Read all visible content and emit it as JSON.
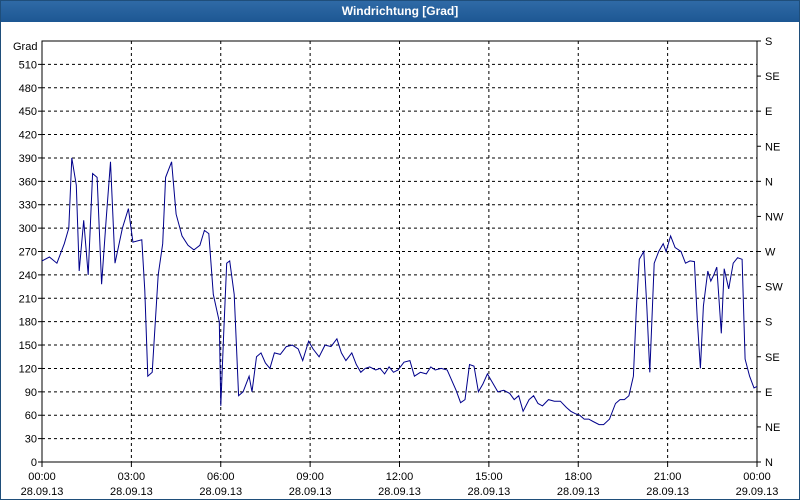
{
  "window": {
    "title": "Windrichtung [Grad]"
  },
  "chart_data": {
    "type": "line",
    "title": "Windrichtung [Grad]",
    "ylabel": "Grad",
    "ylim": [
      0,
      540
    ],
    "yticks": [
      0,
      30,
      60,
      90,
      120,
      150,
      180,
      210,
      240,
      270,
      300,
      330,
      360,
      390,
      420,
      450,
      480,
      510
    ],
    "right_axis": {
      "labels": [
        {
          "value": 0,
          "label": "N"
        },
        {
          "value": 45,
          "label": "NE"
        },
        {
          "value": 90,
          "label": "E"
        },
        {
          "value": 135,
          "label": "SE"
        },
        {
          "value": 180,
          "label": "S"
        },
        {
          "value": 225,
          "label": "SW"
        },
        {
          "value": 270,
          "label": "W"
        },
        {
          "value": 315,
          "label": "NW"
        },
        {
          "value": 360,
          "label": "N"
        },
        {
          "value": 405,
          "label": "NE"
        },
        {
          "value": 450,
          "label": "E"
        },
        {
          "value": 495,
          "label": "SE"
        },
        {
          "value": 540,
          "label": "S"
        }
      ]
    },
    "x_ticks": [
      {
        "time": "00:00",
        "date": "28.09.13",
        "hour": 0
      },
      {
        "time": "03:00",
        "date": "28.09.13",
        "hour": 3
      },
      {
        "time": "06:00",
        "date": "28.09.13",
        "hour": 6
      },
      {
        "time": "09:00",
        "date": "28.09.13",
        "hour": 9
      },
      {
        "time": "12:00",
        "date": "28.09.13",
        "hour": 12
      },
      {
        "time": "15:00",
        "date": "28.09.13",
        "hour": 15
      },
      {
        "time": "18:00",
        "date": "28.09.13",
        "hour": 18
      },
      {
        "time": "21:00",
        "date": "28.09.13",
        "hour": 21
      },
      {
        "time": "00:00",
        "date": "29.09.13",
        "hour": 24
      }
    ],
    "xlim_hours": [
      0,
      24
    ],
    "grid": true,
    "line_color": "#00008b",
    "series": [
      {
        "name": "",
        "points": [
          [
            0.0,
            258
          ],
          [
            0.25,
            263
          ],
          [
            0.5,
            255
          ],
          [
            0.75,
            280
          ],
          [
            0.9,
            300
          ],
          [
            1.0,
            390
          ],
          [
            1.15,
            355
          ],
          [
            1.25,
            245
          ],
          [
            1.4,
            310
          ],
          [
            1.55,
            240
          ],
          [
            1.7,
            370
          ],
          [
            1.85,
            365
          ],
          [
            2.0,
            228
          ],
          [
            2.15,
            310
          ],
          [
            2.3,
            385
          ],
          [
            2.45,
            255
          ],
          [
            2.7,
            300
          ],
          [
            2.9,
            325
          ],
          [
            3.05,
            282
          ],
          [
            3.35,
            285
          ],
          [
            3.45,
            220
          ],
          [
            3.55,
            110
          ],
          [
            3.7,
            115
          ],
          [
            3.9,
            240
          ],
          [
            4.05,
            280
          ],
          [
            4.15,
            365
          ],
          [
            4.35,
            385
          ],
          [
            4.5,
            318
          ],
          [
            4.7,
            290
          ],
          [
            4.9,
            278
          ],
          [
            5.1,
            272
          ],
          [
            5.3,
            278
          ],
          [
            5.45,
            297
          ],
          [
            5.6,
            293
          ],
          [
            5.75,
            215
          ],
          [
            5.95,
            180
          ],
          [
            6.0,
            72
          ],
          [
            6.1,
            165
          ],
          [
            6.2,
            255
          ],
          [
            6.3,
            258
          ],
          [
            6.45,
            215
          ],
          [
            6.6,
            85
          ],
          [
            6.75,
            90
          ],
          [
            6.95,
            110
          ],
          [
            7.05,
            90
          ],
          [
            7.2,
            135
          ],
          [
            7.35,
            140
          ],
          [
            7.5,
            127
          ],
          [
            7.65,
            120
          ],
          [
            7.8,
            140
          ],
          [
            8.0,
            138
          ],
          [
            8.2,
            148
          ],
          [
            8.4,
            150
          ],
          [
            8.6,
            145
          ],
          [
            8.75,
            130
          ],
          [
            8.95,
            155
          ],
          [
            9.1,
            145
          ],
          [
            9.3,
            135
          ],
          [
            9.5,
            150
          ],
          [
            9.7,
            148
          ],
          [
            9.9,
            158
          ],
          [
            10.05,
            140
          ],
          [
            10.2,
            130
          ],
          [
            10.4,
            140
          ],
          [
            10.55,
            125
          ],
          [
            10.7,
            115
          ],
          [
            10.85,
            120
          ],
          [
            11.0,
            122
          ],
          [
            11.2,
            118
          ],
          [
            11.35,
            120
          ],
          [
            11.5,
            113
          ],
          [
            11.65,
            122
          ],
          [
            11.8,
            115
          ],
          [
            11.95,
            118
          ],
          [
            12.15,
            128
          ],
          [
            12.35,
            130
          ],
          [
            12.5,
            110
          ],
          [
            12.7,
            115
          ],
          [
            12.9,
            113
          ],
          [
            13.05,
            122
          ],
          [
            13.2,
            118
          ],
          [
            13.4,
            120
          ],
          [
            13.6,
            118
          ],
          [
            13.75,
            105
          ],
          [
            13.9,
            92
          ],
          [
            14.05,
            76
          ],
          [
            14.2,
            80
          ],
          [
            14.35,
            125
          ],
          [
            14.5,
            123
          ],
          [
            14.65,
            90
          ],
          [
            14.8,
            100
          ],
          [
            14.95,
            113
          ],
          [
            15.15,
            100
          ],
          [
            15.3,
            90
          ],
          [
            15.5,
            92
          ],
          [
            15.7,
            88
          ],
          [
            15.85,
            80
          ],
          [
            16.0,
            85
          ],
          [
            16.15,
            65
          ],
          [
            16.35,
            80
          ],
          [
            16.5,
            85
          ],
          [
            16.65,
            75
          ],
          [
            16.8,
            72
          ],
          [
            17.0,
            80
          ],
          [
            17.2,
            78
          ],
          [
            17.4,
            78
          ],
          [
            17.6,
            70
          ],
          [
            17.75,
            65
          ],
          [
            17.9,
            62
          ],
          [
            18.05,
            60
          ],
          [
            18.2,
            55
          ],
          [
            18.35,
            55
          ],
          [
            18.5,
            52
          ],
          [
            18.7,
            48
          ],
          [
            18.85,
            48
          ],
          [
            19.05,
            55
          ],
          [
            19.25,
            75
          ],
          [
            19.4,
            80
          ],
          [
            19.55,
            80
          ],
          [
            19.7,
            85
          ],
          [
            19.85,
            110
          ],
          [
            19.95,
            195
          ],
          [
            20.05,
            260
          ],
          [
            20.2,
            270
          ],
          [
            20.3,
            200
          ],
          [
            20.4,
            115
          ],
          [
            20.55,
            255
          ],
          [
            20.7,
            270
          ],
          [
            20.85,
            280
          ],
          [
            20.95,
            270
          ],
          [
            21.1,
            290
          ],
          [
            21.25,
            275
          ],
          [
            21.45,
            270
          ],
          [
            21.6,
            255
          ],
          [
            21.75,
            258
          ],
          [
            21.9,
            257
          ],
          [
            22.0,
            180
          ],
          [
            22.1,
            120
          ],
          [
            22.2,
            200
          ],
          [
            22.35,
            245
          ],
          [
            22.45,
            232
          ],
          [
            22.55,
            240
          ],
          [
            22.65,
            250
          ],
          [
            22.8,
            165
          ],
          [
            22.9,
            248
          ],
          [
            23.05,
            222
          ],
          [
            23.2,
            255
          ],
          [
            23.35,
            262
          ],
          [
            23.5,
            260
          ],
          [
            23.6,
            132
          ],
          [
            23.75,
            110
          ],
          [
            23.9,
            95
          ],
          [
            24.0,
            97
          ]
        ]
      }
    ]
  }
}
